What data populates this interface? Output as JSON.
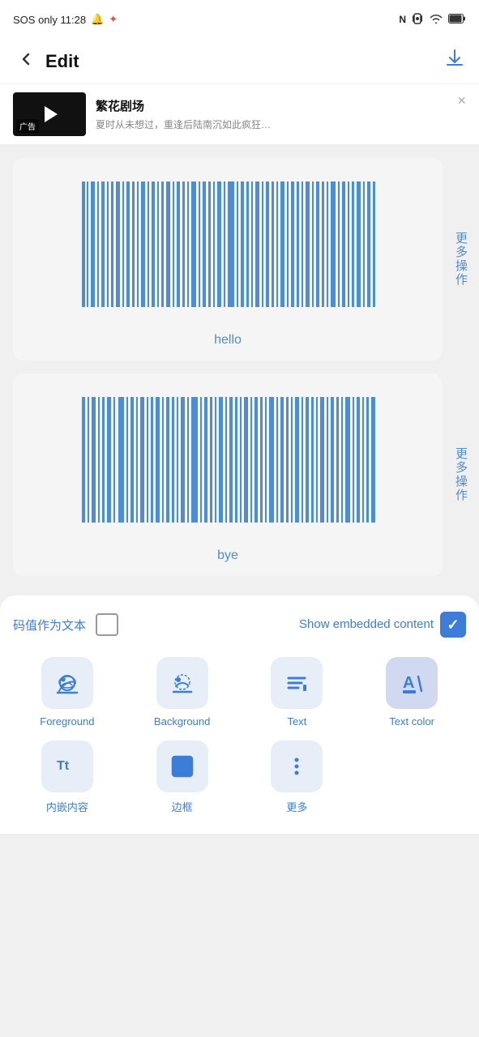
{
  "statusBar": {
    "left": "SOS only  11:28",
    "bell_icon": "🔔",
    "star_icon": "✦",
    "nfc_icon": "N",
    "vibrate_icon": "📳",
    "wifi_icon": "📶",
    "battery_icon": "🔋"
  },
  "topBar": {
    "back_label": "‹",
    "title": "Edit",
    "download_label": "⬇"
  },
  "adBanner": {
    "title": "繁花剧场",
    "description": "夏时从未想过，重逢后陆南沉如此疯狂…",
    "close_label": "×",
    "ad_label": "广告"
  },
  "barcodes": [
    {
      "id": "barcode-1",
      "label": "hello",
      "more_action": "更多操作"
    },
    {
      "id": "barcode-2",
      "label": "bye",
      "more_action": "更多操作"
    }
  ],
  "bottomSheet": {
    "code_as_text_label": "码值作为文本",
    "show_embedded_label": "Show embedded content",
    "code_as_text_checked": false,
    "show_embedded_checked": true
  },
  "tools": [
    {
      "id": "foreground",
      "name": "Foreground",
      "icon": "palette"
    },
    {
      "id": "background",
      "name": "Background",
      "icon": "palette2"
    },
    {
      "id": "text",
      "name": "Text",
      "icon": "text-align"
    },
    {
      "id": "text-color",
      "name": "Text color",
      "icon": "font-color",
      "active": true
    }
  ],
  "tools2": [
    {
      "id": "embedded",
      "name": "内嵌内容",
      "icon": "tt"
    },
    {
      "id": "border",
      "name": "边框",
      "icon": "border"
    },
    {
      "id": "more",
      "name": "更多",
      "icon": "dots"
    },
    {
      "id": "empty",
      "name": "",
      "icon": ""
    }
  ]
}
